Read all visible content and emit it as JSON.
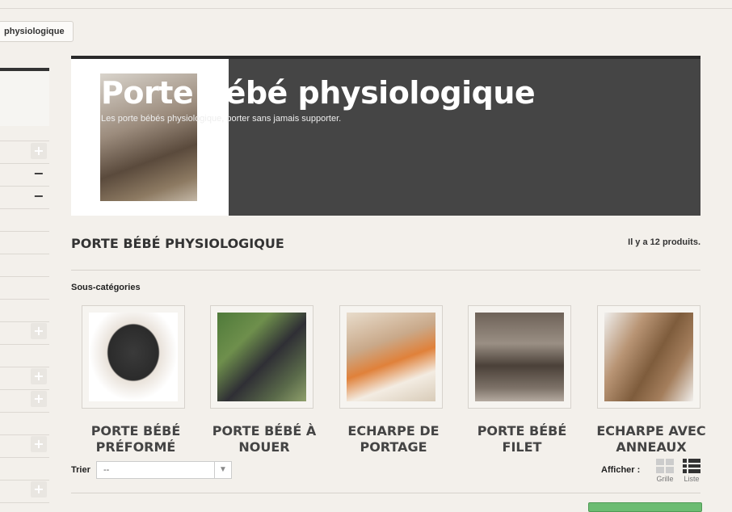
{
  "breadcrumb": {
    "current": "physiologique"
  },
  "banner": {
    "title": "Porte bébé physiologique",
    "subtitle": "Les porte bébés physiologique, porter sans jamais supporter."
  },
  "category": {
    "heading": "PORTE BÉBÉ PHYSIOLOGIQUE",
    "count_text": "Il y a 12 produits."
  },
  "subcategories": {
    "label": "Sous-catégories",
    "items": [
      {
        "name_line1": "PORTE BÉBÉ",
        "name_line2": "PRÉFORMÉ"
      },
      {
        "name_line1": "PORTE BÉBÉ À",
        "name_line2": "NOUER"
      },
      {
        "name_line1": "ECHARPE DE",
        "name_line2": "PORTAGE"
      },
      {
        "name_line1": "PORTE BÉBÉ",
        "name_line2": "FILET"
      },
      {
        "name_line1": "ECHARPE AVEC",
        "name_line2": "ANNEAUX"
      }
    ]
  },
  "sort": {
    "label": "Trier",
    "value": "--"
  },
  "display": {
    "label": "Afficher :",
    "grid_label": "Grille",
    "list_label": "Liste"
  },
  "sidebar": {
    "toggles": [
      "+",
      "−",
      "−",
      "+",
      "+",
      "+",
      "+",
      "+"
    ]
  },
  "colors": {
    "banner_bg": "#454545",
    "page_bg": "#f3f0eb",
    "accent_green": "#6cbc72"
  }
}
